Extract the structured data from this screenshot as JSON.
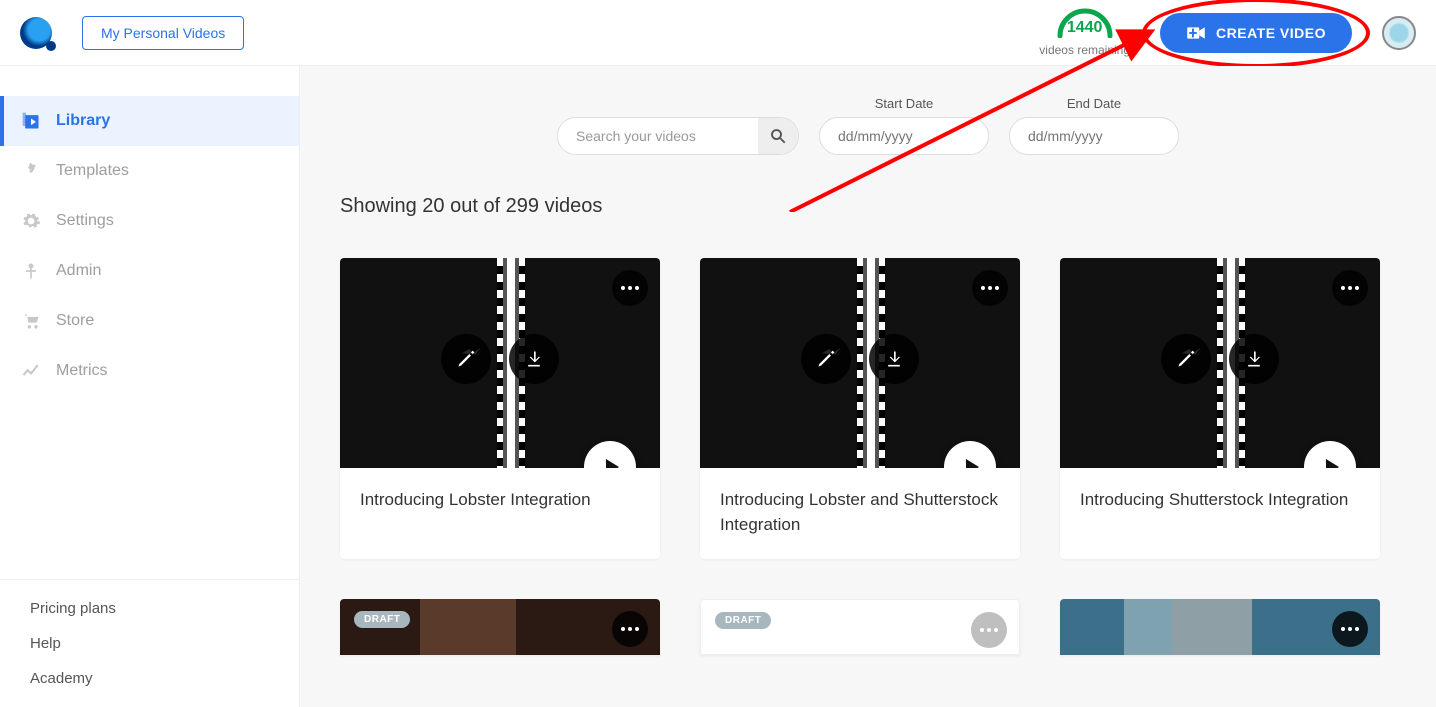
{
  "header": {
    "personal_btn": "My Personal Videos",
    "videos_remaining_count": "1440",
    "videos_remaining_label": "videos remaining",
    "create_btn": "CREATE VIDEO"
  },
  "sidebar": {
    "items": [
      {
        "label": "Library",
        "icon": "library-icon",
        "active": true
      },
      {
        "label": "Templates",
        "icon": "templates-icon"
      },
      {
        "label": "Settings",
        "icon": "settings-icon"
      },
      {
        "label": "Admin",
        "icon": "admin-icon"
      },
      {
        "label": "Store",
        "icon": "store-icon"
      },
      {
        "label": "Metrics",
        "icon": "metrics-icon"
      }
    ],
    "footer": [
      {
        "label": "Pricing plans"
      },
      {
        "label": "Help"
      },
      {
        "label": "Academy"
      }
    ]
  },
  "filters": {
    "search_placeholder": "Search your videos",
    "start_label": "Start Date",
    "end_label": "End Date",
    "date_placeholder": "dd/mm/yyyy"
  },
  "results_text": "Showing 20 out of 299 videos",
  "videos": [
    {
      "title": "Introducing Lobster Integration"
    },
    {
      "title": "Introducing Lobster and Shutterstock Integration"
    },
    {
      "title": "Introducing Shutterstock Integration"
    }
  ],
  "draft_label": "DRAFT"
}
